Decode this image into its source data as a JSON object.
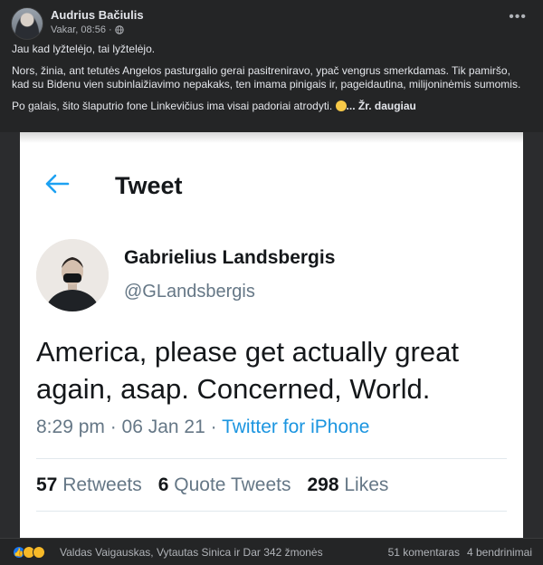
{
  "post": {
    "author": "Audrius Bačiulis",
    "time": "Vakar, 08:56",
    "separator": "·",
    "paragraphs": [
      "Jau kad lyžtelėjo, tai lyžtelėjo.",
      "Nors, žinia, ant tetutės Angelos pasturgalio gerai pasitreniravo, ypač vengrus smerkdamas. Tik pamiršo, kad su Bidenu vien subinlaižiavimo nepakaks, ten imama pinigais ir, pageidautina, milijoninėmis sumomis.",
      "Po galais, šito šlaputrio fone Linkevičius ima visai padoriai atrodyti."
    ],
    "see_more": "... Žr. daugiau",
    "more_icon": "more-horizontal-icon",
    "privacy_icon": "globe-icon"
  },
  "tweet": {
    "title": "Tweet",
    "name": "Gabrielius Landsbergis",
    "handle": "@GLandsbergis",
    "body": "America, please get actually great again, asap. Concerned, World.",
    "time": "8:29 pm · 06 Jan 21 · ",
    "source": "Twitter for iPhone",
    "retweets_count": "57",
    "retweets_label": "Retweets",
    "quote_count": "6",
    "quote_label": "Quote Tweets",
    "likes_count": "298",
    "likes_label": "Likes"
  },
  "footer": {
    "reactors": "Valdas Vaigauskas, Vytautas Sinica ir Dar 342 žmonės",
    "comments": "51 komentaras",
    "shares": "4 bendrinimai"
  },
  "colors": {
    "fb_background": "#242526",
    "fb_text": "#e4e6eb",
    "fb_secondary": "#b0b3b8",
    "twitter_blue": "#1b95e0",
    "twitter_gray": "#657786"
  }
}
